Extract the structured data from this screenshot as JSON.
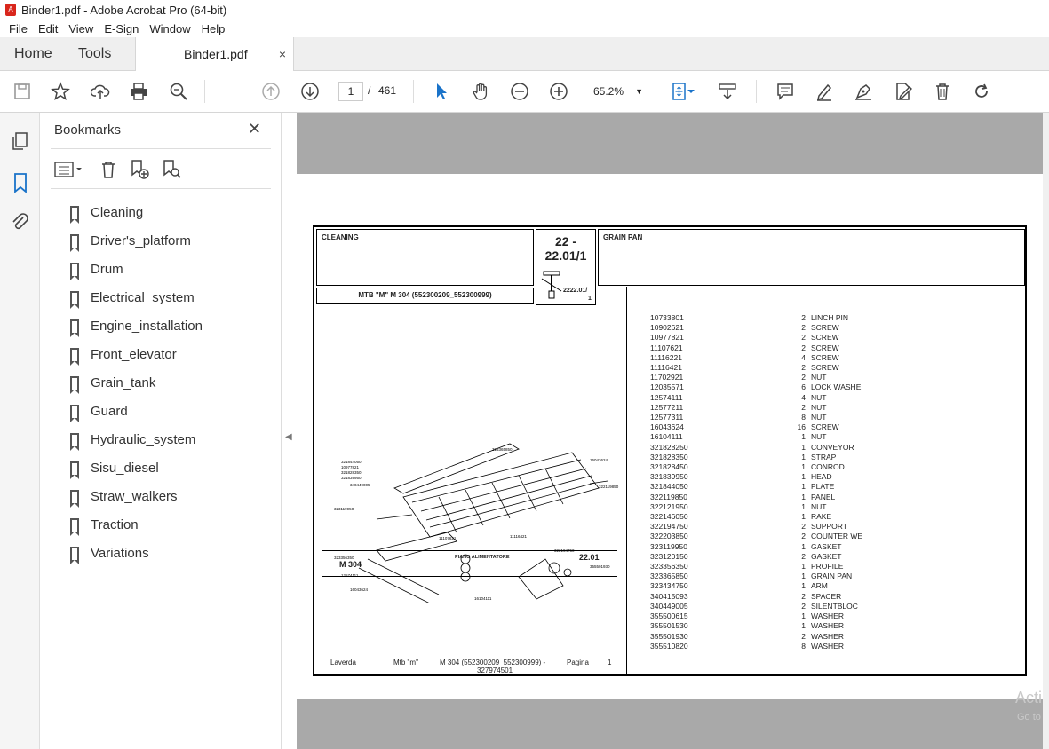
{
  "window": {
    "title": "Binder1.pdf - Adobe Acrobat Pro (64-bit)"
  },
  "menu": [
    "File",
    "Edit",
    "View",
    "E-Sign",
    "Window",
    "Help"
  ],
  "tabs": {
    "home": "Home",
    "tools": "Tools",
    "doc": "Binder1.pdf",
    "close": "×"
  },
  "toolbar": {
    "page_current": "1",
    "page_sep": "/",
    "page_total": "461",
    "zoom": "65.2%"
  },
  "bookmarks": {
    "title": "Bookmarks",
    "items": [
      "Cleaning",
      "Driver's_platform",
      "Drum",
      "Electrical_system",
      "Engine_installation",
      "Front_elevator",
      "Grain_tank",
      "Guard",
      "Hydraulic_system",
      "Sisu_diesel",
      "Straw_walkers",
      "Traction",
      "Variations"
    ]
  },
  "doc": {
    "section": "CLEANING",
    "code_top": "22 -",
    "code_bottom": "22.01/1",
    "group_title": "GRAIN PAN",
    "model_line": "MTB \"M\" M 304 (552300209_552300999)",
    "small_code": "2222.01/",
    "small_code2": "1",
    "drawing_model": "M 304",
    "drawing_title": "PIANO ALIMENTATORE",
    "drawing_code": "22.01",
    "footer_brand": "Laverda",
    "footer_mtb": "Mtb \"m\"",
    "footer_model": "M 304 (552300209_552300999) -",
    "footer_model2": "327974501",
    "footer_page_label": "Pagina",
    "footer_page": "1",
    "parts": [
      [
        "10733801",
        "2",
        "LINCH PIN"
      ],
      [
        "10902621",
        "2",
        "SCREW"
      ],
      [
        "10977821",
        "2",
        "SCREW"
      ],
      [
        "11107621",
        "2",
        "SCREW"
      ],
      [
        "11116221",
        "4",
        "SCREW"
      ],
      [
        "11116421",
        "2",
        "SCREW"
      ],
      [
        "11702921",
        "2",
        "NUT"
      ],
      [
        "12035571",
        "6",
        "LOCK WASHE"
      ],
      [
        "12574111",
        "4",
        "NUT"
      ],
      [
        "12577211",
        "2",
        "NUT"
      ],
      [
        "12577311",
        "8",
        "NUT"
      ],
      [
        "16043624",
        "16",
        "SCREW"
      ],
      [
        "16104111",
        "1",
        "NUT"
      ],
      [
        "321828250",
        "1",
        "CONVEYOR"
      ],
      [
        "321828350",
        "1",
        "STRAP"
      ],
      [
        "321828450",
        "1",
        "CONROD"
      ],
      [
        "321839950",
        "1",
        "HEAD"
      ],
      [
        "321844050",
        "1",
        "PLATE"
      ],
      [
        "322119850",
        "1",
        "PANEL"
      ],
      [
        "322121950",
        "1",
        "NUT"
      ],
      [
        "322146050",
        "1",
        "RAKE"
      ],
      [
        "322194750",
        "2",
        "SUPPORT"
      ],
      [
        "322203850",
        "2",
        "COUNTER WE"
      ],
      [
        "323119950",
        "1",
        "GASKET"
      ],
      [
        "323120150",
        "2",
        "GASKET"
      ],
      [
        "323356350",
        "1",
        "PROFILE"
      ],
      [
        "323365850",
        "1",
        "GRAIN PAN"
      ],
      [
        "323434750",
        "1",
        "ARM"
      ],
      [
        "340415093",
        "2",
        "SPACER"
      ],
      [
        "340449005",
        "2",
        "SILENTBLOC"
      ],
      [
        "355500615",
        "1",
        "WASHER"
      ],
      [
        "355501530",
        "1",
        "WASHER"
      ],
      [
        "355501930",
        "2",
        "WASHER"
      ],
      [
        "355510820",
        "8",
        "WASHER"
      ]
    ]
  },
  "watermark": {
    "line1": "Acti",
    "line2": "Go to"
  }
}
